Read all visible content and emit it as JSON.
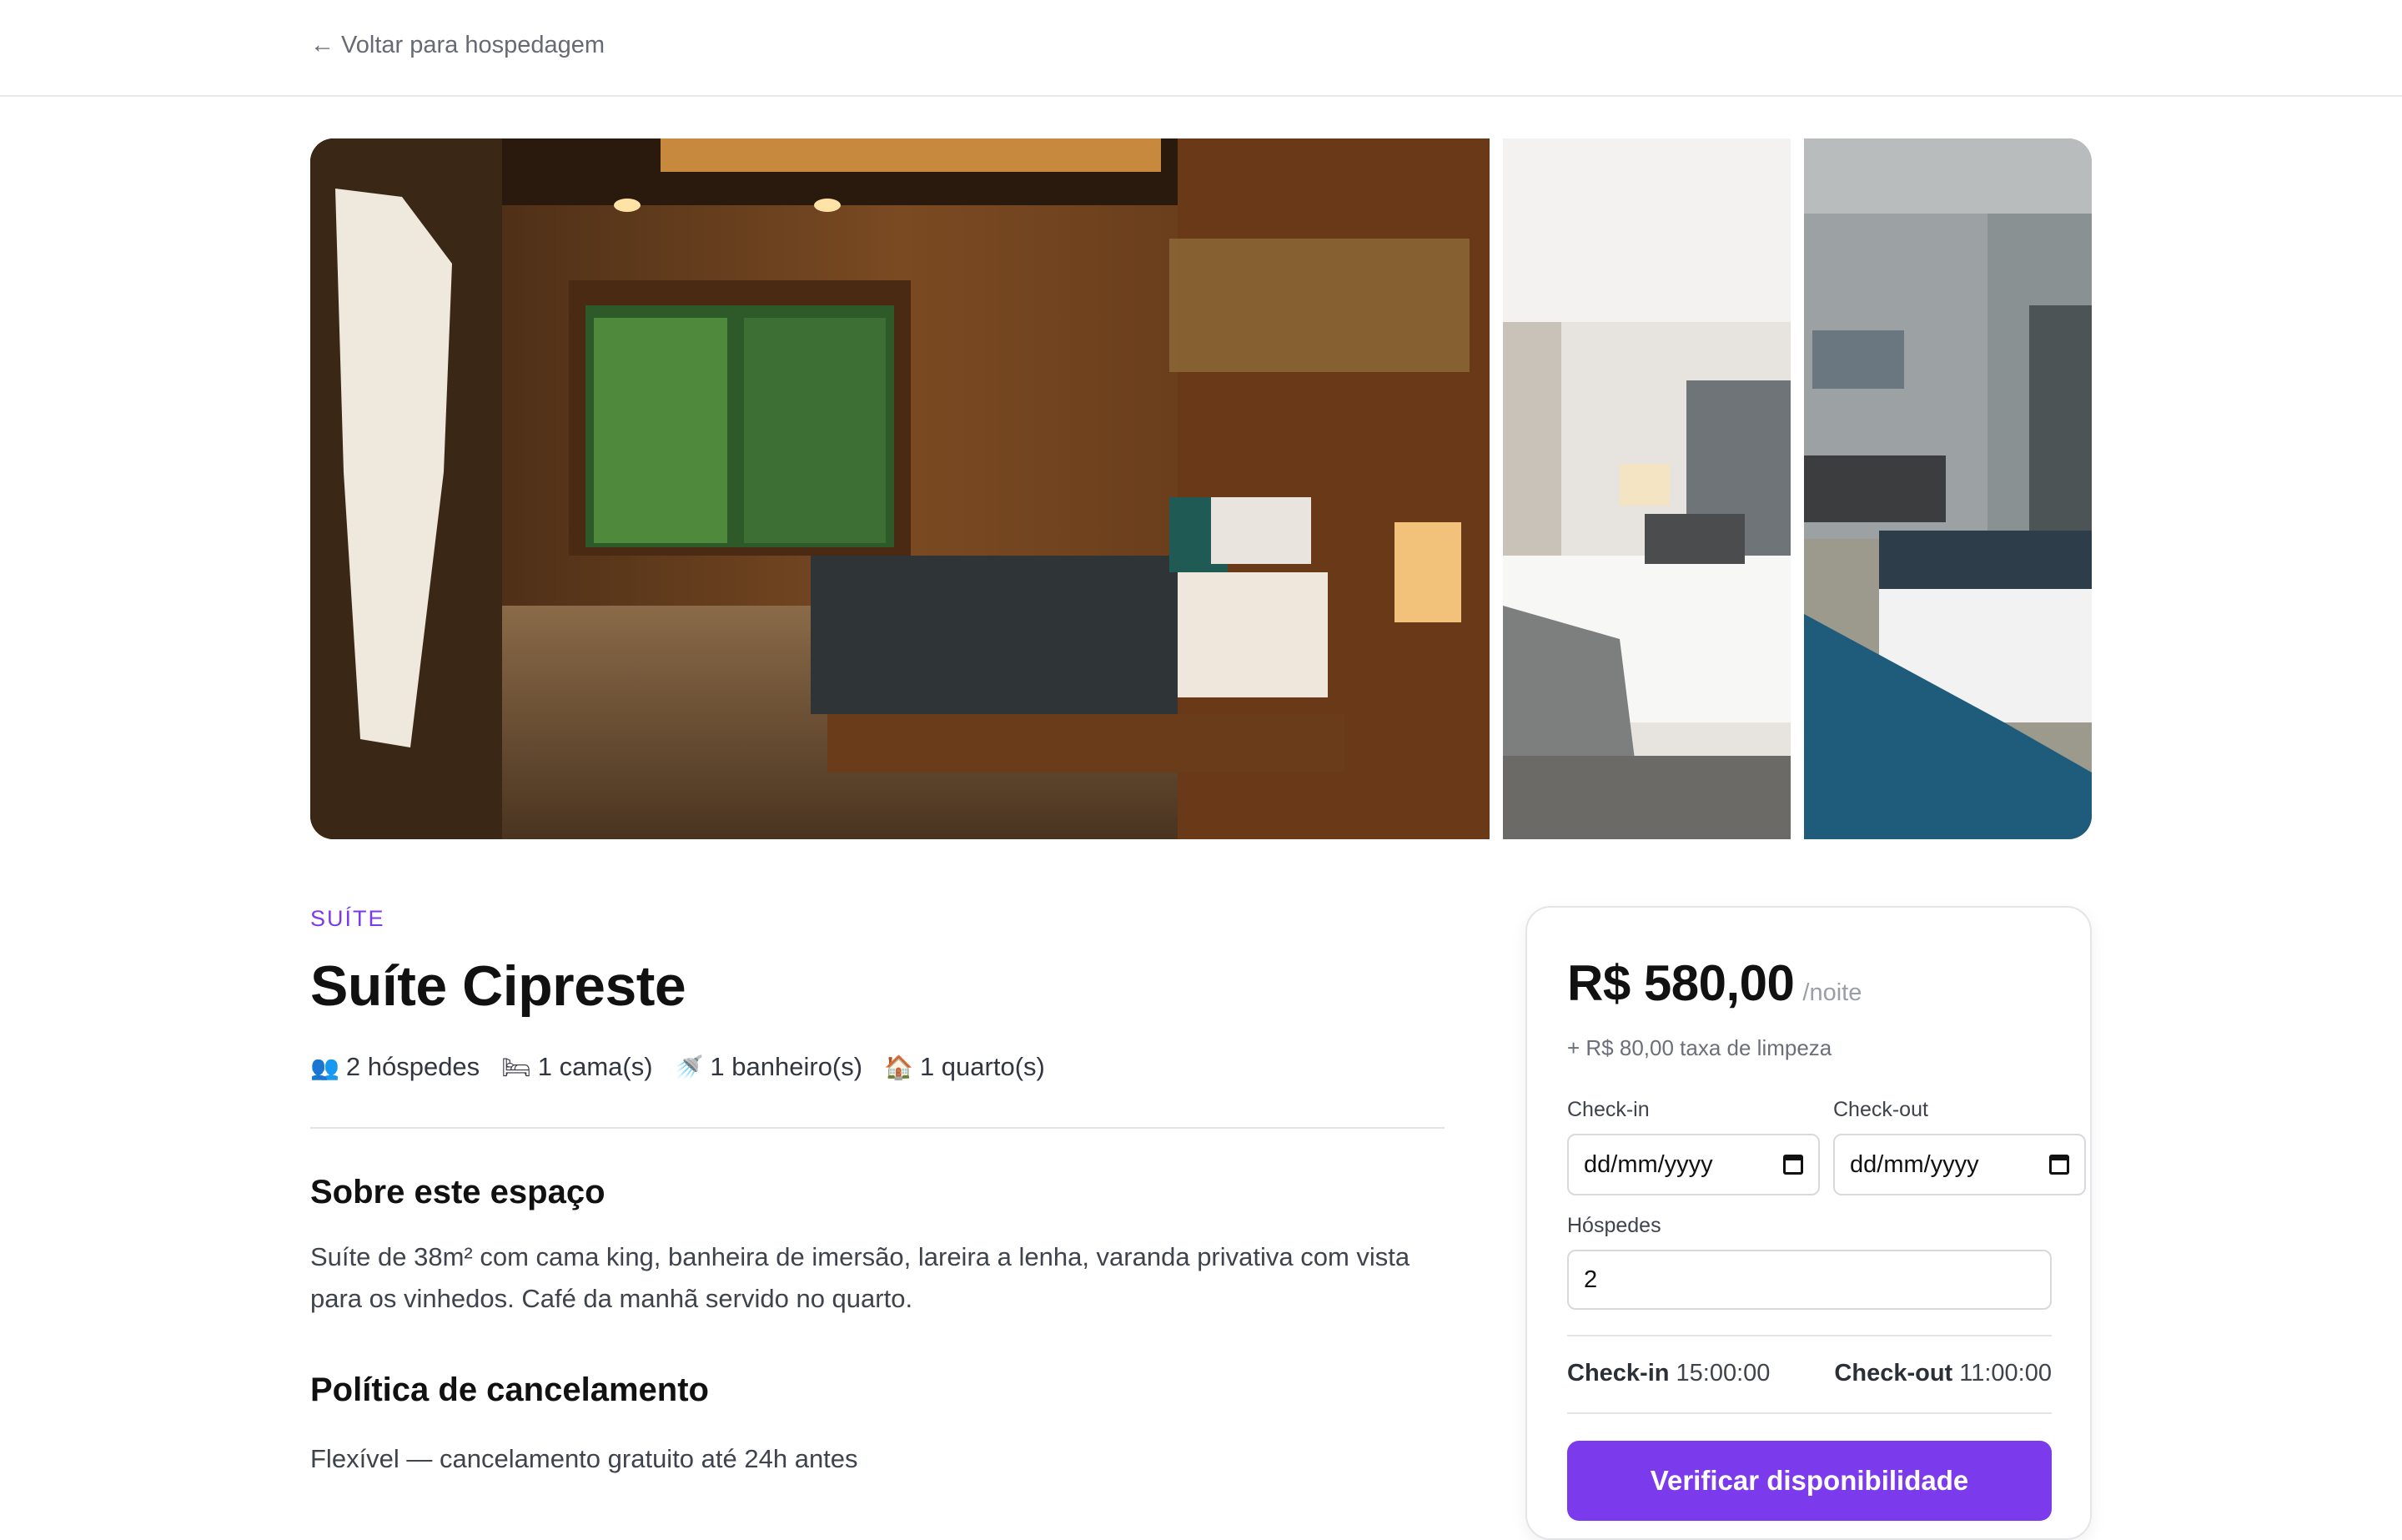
{
  "nav": {
    "back_label": "← Voltar para hospedagem"
  },
  "gallery": {
    "photos": [
      {
        "name": "main-room-photo"
      },
      {
        "name": "second-room-photo"
      },
      {
        "name": "third-room-photo"
      }
    ]
  },
  "room": {
    "type": "SUÍTE",
    "title": "Suíte Cipreste",
    "features": {
      "guests": "2 hóspedes",
      "beds": "1 cama(s)",
      "baths": "1 banheiro(s)",
      "rooms": "1 quarto(s)"
    },
    "feature_icons": {
      "guests": "👥",
      "beds": "🛏",
      "baths": "🚿",
      "rooms": "🏠"
    },
    "about_title": "Sobre este espaço",
    "about_text": "Suíte de 38m² com cama king, banheira de imersão, lareira a lenha, varanda privativa com vista para os vinhedos. Café da manhã servido no quarto.",
    "cancel_title": "Política de cancelamento",
    "cancel_text": "Flexível — cancelamento gratuito até 24h antes"
  },
  "booking": {
    "price": "R$ 580,00",
    "per_night": "/noite",
    "cleaning_fee": "+ R$ 80,00 taxa de limpeza",
    "checkin_label": "Check-in",
    "checkout_label": "Check-out",
    "checkin_value": "dd/mm/yyyy",
    "checkout_value": "dd/mm/yyyy",
    "guests_label": "Hóspedes",
    "guests_value": "2",
    "checkin_time_label": "Check-in",
    "checkin_time": "15:00:00",
    "checkout_time_label": "Check-out",
    "checkout_time": "11:00:00",
    "cta_label": "Verificar disponibilidade"
  },
  "colors": {
    "accent": "#7c3aed",
    "text": "#111111",
    "muted": "#6b6f78"
  }
}
